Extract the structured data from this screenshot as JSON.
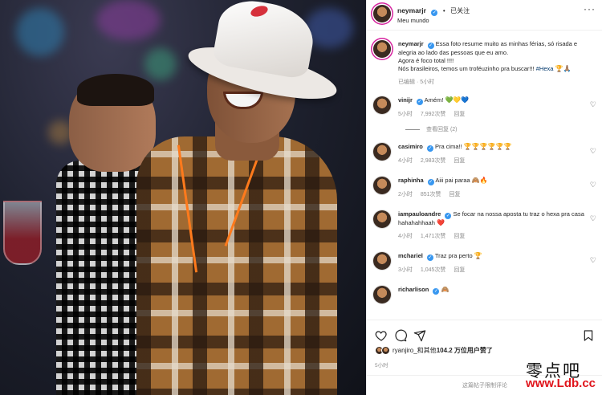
{
  "post": {
    "username": "neymarjr",
    "follow_status": "已关注",
    "location": "Meu mundo"
  },
  "caption": {
    "username": "neymarjr",
    "line1": "Essa foto resume muito as minhas férias, só risada e alegria ao lado das pessoas que eu amo.",
    "line2": "Agora é foco total !!!!",
    "line3": "Nós brasileiros, temos um troféuzinho pra buscar!!!",
    "hashtag": "#Hexa",
    "emoji": "🏆🙏🏽",
    "meta": "已编辑 · 5小时"
  },
  "comments": [
    {
      "username": "vinijr",
      "text": "Amém!",
      "emoji": "💚💛💙",
      "time": "5小时",
      "likes": "7,992次赞",
      "reply": "回复"
    },
    {
      "username": "casimiro",
      "text": "Pra cima!!",
      "emoji": "🏆🏆🏆🏆🏆🏆",
      "time": "4小时",
      "likes": "2,983次赞",
      "reply": "回复"
    },
    {
      "username": "raphinha",
      "text": "Aiii pai paraa",
      "emoji": "🙈🔥",
      "time": "2小时",
      "likes": "851次赞",
      "reply": "回复"
    },
    {
      "username": "iampauloandre",
      "text": "Se focar na nossa aposta tu traz o hexa pra casa hahahahhaah",
      "emoji": "❤️",
      "time": "4小时",
      "likes": "1,471次赞",
      "reply": "回复"
    },
    {
      "username": "mchariel",
      "text": "Traz pra perto",
      "emoji": "🏆",
      "time": "3小时",
      "likes": "1,045次赞",
      "reply": "回复"
    },
    {
      "username": "richarlison",
      "text": "",
      "emoji": "🙈",
      "time": "",
      "likes": "",
      "reply": ""
    }
  ],
  "replies_toggle": "查看回复 (2)",
  "likes": {
    "prefix": "ryanjiro_和其他",
    "count": "104.2 万位用户赞了"
  },
  "post_time": "5小时",
  "comments_restricted": "这篇帖子限制评论",
  "watermark": {
    "chinese": "零点吧",
    "url": "www.Ldb.cc"
  },
  "colors": {
    "verified": "#3897f0",
    "hashtag": "#00376b",
    "muted": "#8e8e8e",
    "watermark_red": "#e0141b"
  },
  "icons": [
    "more-icon",
    "verified-badge-icon",
    "heart-icon",
    "comment-icon",
    "share-icon",
    "save-icon"
  ]
}
